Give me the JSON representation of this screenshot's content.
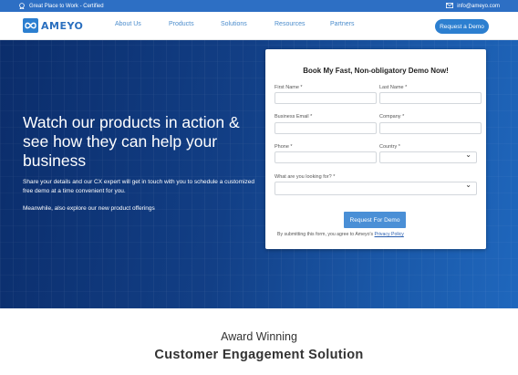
{
  "topbar": {
    "certified": "Great Place to Work - Certified",
    "email": "info@ameyo.com"
  },
  "header": {
    "logo_text": "AMEYO",
    "nav": [
      "About Us",
      "Products",
      "Solutions",
      "Resources",
      "Partners"
    ],
    "cta": "Request a Demo"
  },
  "hero": {
    "headline": "Watch our products in action & see how they can help your business",
    "sub1": "Share your details and our CX expert will get in touch with you to schedule a customized free demo at a time convenient for you.",
    "sub2": "Meanwhile, also explore our new product offerings"
  },
  "form": {
    "title": "Book My Fast, Non-obligatory Demo Now!",
    "first_name": "First Name *",
    "last_name": "Last Name *",
    "business_email": "Business Email *",
    "company": "Company *",
    "phone": "Phone *",
    "country": "Country *",
    "looking_for": "What are you looking for? *",
    "submit": "Request For Demo",
    "legal_text": "By submitting this form, you agree to Ameyo's",
    "privacy_link": "Privacy Policy"
  },
  "award": {
    "line1": "Award Winning",
    "line2": "Customer Engagement Solution"
  },
  "colors": {
    "topbar": "#2d6fc4",
    "accent": "#2c7fd0",
    "hero_dark": "#0b2d6b",
    "hero_light": "#1f67bd",
    "submit": "#4a8fd6"
  }
}
